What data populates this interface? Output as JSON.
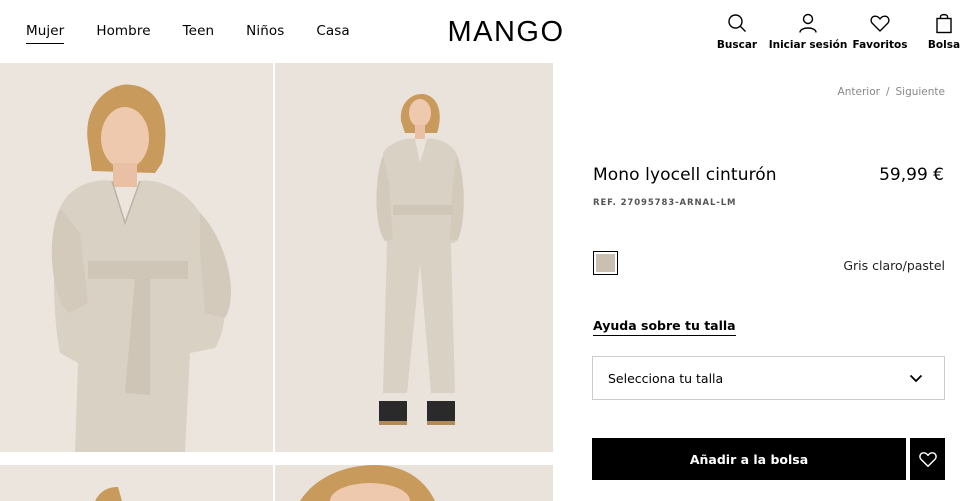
{
  "nav": {
    "items": [
      {
        "label": "Mujer",
        "active": true
      },
      {
        "label": "Hombre"
      },
      {
        "label": "Teen"
      },
      {
        "label": "Niños"
      },
      {
        "label": "Casa"
      }
    ]
  },
  "brand": {
    "logo_text": "MANGO"
  },
  "actions": {
    "search": "Buscar",
    "login": "Iniciar sesión",
    "favorites": "Favoritos",
    "bag": "Bolsa"
  },
  "pager": {
    "prev": "Anterior",
    "separator": "/",
    "next": "Siguiente"
  },
  "product": {
    "title": "Mono lyocell cinturón",
    "price": "59,99 €",
    "ref": "REF. 27095783-ARNAL-LM",
    "color_name": "Gris claro/pastel",
    "color_hex": "#c9c0b2"
  },
  "size": {
    "help_link": "Ayuda sobre tu talla",
    "select_placeholder": "Selecciona tu talla"
  },
  "cta": {
    "add_to_bag": "Añadir a la bolsa"
  },
  "colors": {
    "accent": "#000000",
    "photo_bg": "#e8e2db",
    "garment": "#d8d0c2"
  }
}
